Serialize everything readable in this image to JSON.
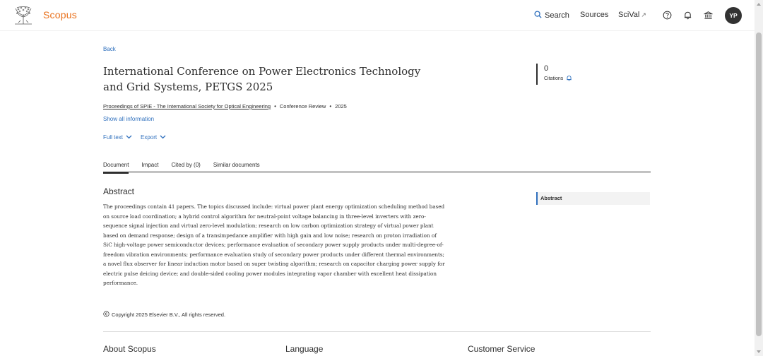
{
  "header": {
    "brand": "Scopus",
    "nav": {
      "search_label": "Search",
      "sources_label": "Sources",
      "scival_label": "SciVal"
    },
    "avatar_initials": "YP",
    "accent_color": "#e9711c"
  },
  "page": {
    "back_label": "Back",
    "title": "International Conference on Power Electronics Technology and Grid Systems, PETGS 2025",
    "citations": {
      "count": "0",
      "label": "Citations"
    },
    "meta": {
      "source": "Proceedings of SPIE - The International Society for Optical Engineering",
      "doc_type": "Conference Review",
      "year": "2025"
    },
    "show_all_label": "Show all information",
    "actions": {
      "full_text": "Full text",
      "export": "Export"
    },
    "tabs": [
      {
        "label": "Document"
      },
      {
        "label": "Impact"
      },
      {
        "label": "Cited by (0)"
      },
      {
        "label": "Similar documents"
      }
    ],
    "abstract_heading": "Abstract",
    "abstract_text": "The proceedings contain 41 papers. The topics discussed include: virtual power plant energy optimization scheduling method based on source load coordination; a hybrid control algorithm for neutral-point voltage balancing in three-level inverters with zero-sequence signal injection and virtual zero-level modulation; research on low carbon optimization strategy of virtual power plant based on demand response; design of a transimpedance amplifier with high gain and low noise; research on proton irradiation of SiC high-voltage power semiconductor devices; performance evaluation of secondary power supply products under multi-degree-of-freedom vibration environments; performance evaluation study of secondary power products under different thermal environments; a novel flux observer for linear induction motor based on super twisting algorithm; research on capacitor charging power supply for electric pulse deicing device; and double-sided cooling power modules integrating vapor chamber with excellent heat dissipation performance.",
    "side_nav_label": "Abstract",
    "copyright": "Copyright 2025 Elsevier B.V., All rights reserved."
  },
  "footer": {
    "col1": "About Scopus",
    "col2": "Language",
    "col3": "Customer Service"
  },
  "colors": {
    "link": "#2e6fbd",
    "text": "#2e2e2e"
  }
}
